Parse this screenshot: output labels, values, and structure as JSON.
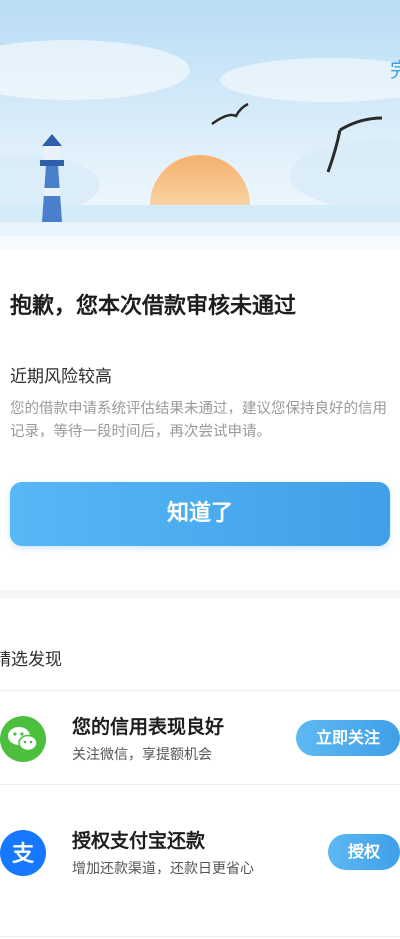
{
  "header": {
    "done_label": "完"
  },
  "result": {
    "title": "抱歉，您本次借款审核未通过",
    "reason": "近期风险较高",
    "description": "您的借款申请系统评估结果未通过，建议您保持良好的信用记录，等待一段时间后，再次尝试申请。",
    "ok_label": "知道了"
  },
  "discover": {
    "title": "精选发现",
    "items": [
      {
        "title": "您的信用表现良好",
        "subtitle": "关注微信，享提额机会",
        "button": "立即关注",
        "icon": "wechat-icon",
        "icon_color": "#4cbf3f"
      },
      {
        "title": "授权支付宝还款",
        "subtitle": "增加还款渠道，还款日更省心",
        "button": "授权",
        "icon": "alipay-icon",
        "icon_color": "#1677ff"
      }
    ]
  },
  "colors": {
    "accent": "#46a7ee",
    "wechat": "#4cbf3f",
    "alipay": "#1677ff"
  }
}
